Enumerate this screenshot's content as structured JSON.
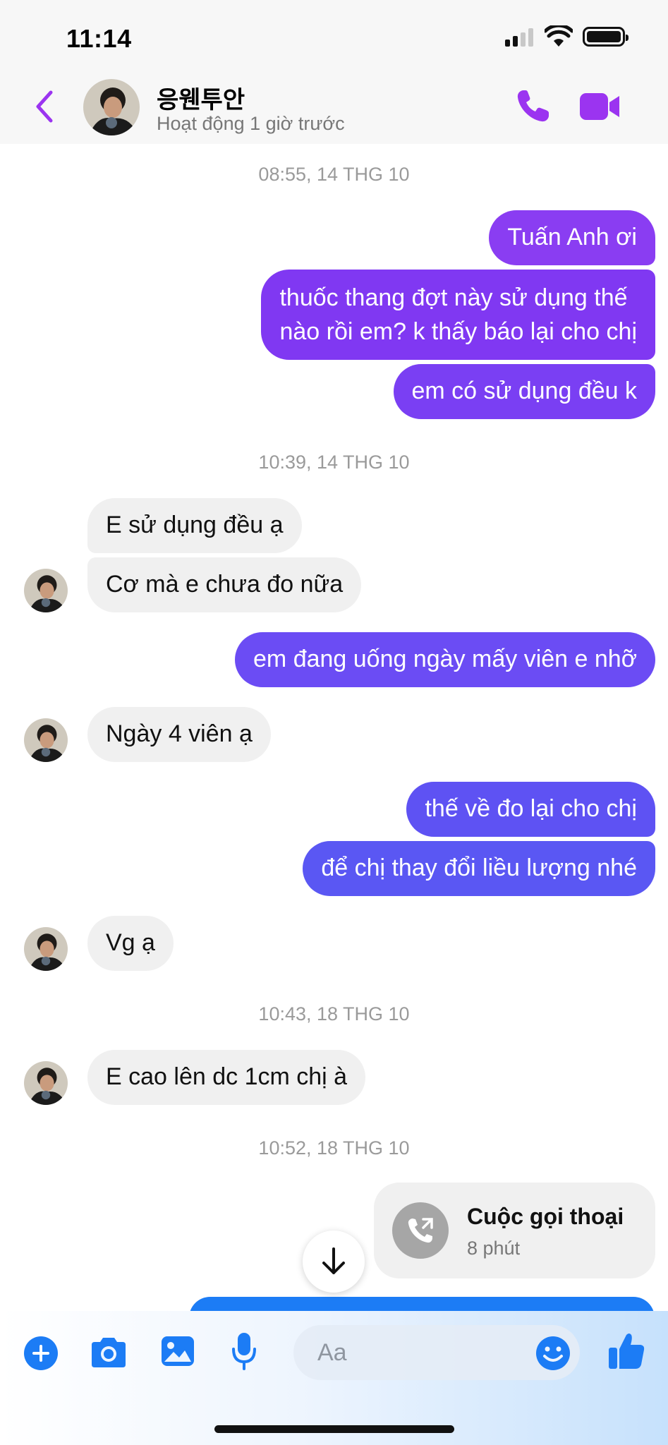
{
  "status_bar": {
    "time": "11:14"
  },
  "header": {
    "contact_name": "응웬투안",
    "activity": "Hoạt động 1 giờ trước"
  },
  "messages": {
    "ts1": "08:55, 14 THG 10",
    "m1": "Tuấn Anh ơi",
    "m2_line1": "thuốc thang đợt này sử dụng thế",
    "m2_line2": "nào rồi em? k thấy báo lại cho chị",
    "m3": "em có sử dụng đều k",
    "ts2": "10:39, 14 THG 10",
    "m4": "E sử dụng đều ạ",
    "m5": "Cơ mà e chưa đo nữa",
    "m6": "em đang uống ngày mấy viên e nhỡ",
    "m7": "Ngày 4 viên ạ",
    "m8": "thế về đo lại cho chị",
    "m9": "để chị thay đổi liều lượng nhé",
    "m10": "Vg ạ",
    "ts3": "10:43, 18 THG 10",
    "m11": "E cao lên dc 1cm chị à",
    "ts4": "10:52, 18 THG 10",
    "call_title": "Cuộc gọi thoại",
    "call_duration": "8 phút"
  },
  "composer": {
    "placeholder": "Aa"
  },
  "colors": {
    "accent_purple": "#9b34f0",
    "bubble_purple": "#8a3df2",
    "bubble_indigo": "#6b4cf4",
    "bubble_blue": "#5a57f3",
    "messenger_blue": "#1c7cf5",
    "incoming_bubble": "#f0f0f0"
  },
  "icons": [
    "back-icon",
    "phone-icon",
    "video-icon",
    "plus-icon",
    "camera-icon",
    "image-icon",
    "mic-icon",
    "emoji-icon",
    "thumbs-up-icon",
    "arrow-down-icon",
    "call-out-icon"
  ]
}
